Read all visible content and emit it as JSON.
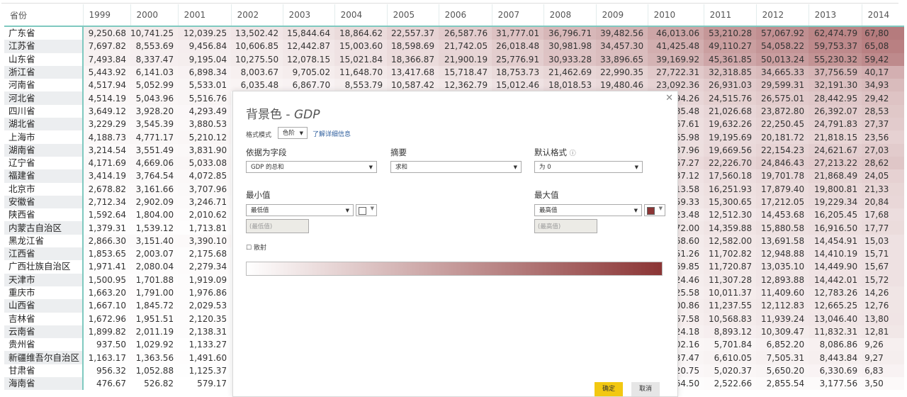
{
  "table": {
    "header_label": "省份",
    "years": [
      "1999",
      "2000",
      "2001",
      "2002",
      "2003",
      "2004",
      "2005",
      "2006",
      "2007",
      "2008",
      "2009",
      "2010",
      "2011",
      "2012",
      "2013",
      "2014"
    ],
    "rows": [
      {
        "province": "广东省",
        "values": [
          "9,250.68",
          "10,741.25",
          "12,039.25",
          "13,502.42",
          "15,844.64",
          "18,864.62",
          "22,557.37",
          "26,587.76",
          "31,777.01",
          "36,796.71",
          "39,482.56",
          "46,013.06",
          "53,210.28",
          "57,067.92",
          "62,474.79",
          "67,80"
        ]
      },
      {
        "province": "江苏省",
        "values": [
          "7,697.82",
          "8,553.69",
          "9,456.84",
          "10,606.85",
          "12,442.87",
          "15,003.60",
          "18,598.69",
          "21,742.05",
          "26,018.48",
          "30,981.98",
          "34,457.30",
          "41,425.48",
          "49,110.27",
          "54,058.22",
          "59,753.37",
          "65,08"
        ]
      },
      {
        "province": "山东省",
        "values": [
          "7,493.84",
          "8,337.47",
          "9,195.04",
          "10,275.50",
          "12,078.15",
          "15,021.84",
          "18,366.87",
          "21,900.19",
          "25,776.91",
          "30,933.28",
          "33,896.65",
          "39,169.92",
          "45,361.85",
          "50,013.24",
          "55,230.32",
          "59,42"
        ]
      },
      {
        "province": "浙江省",
        "values": [
          "5,443.92",
          "6,141.03",
          "6,898.34",
          "8,003.67",
          "9,705.02",
          "11,648.70",
          "13,417.68",
          "15,718.47",
          "18,753.73",
          "21,462.69",
          "22,990.35",
          "27,722.31",
          "32,318.85",
          "34,665.33",
          "37,756.59",
          "40,17"
        ]
      },
      {
        "province": "河南省",
        "values": [
          "4,517.94",
          "5,052.99",
          "5,533.01",
          "6,035.48",
          "6,867.70",
          "8,553.79",
          "10,587.42",
          "12,362.79",
          "15,012.46",
          "18,018.53",
          "19,480.46",
          "23,092.36",
          "26,931.03",
          "29,599.31",
          "32,191.30",
          "34,93"
        ]
      },
      {
        "province": "河北省",
        "values": [
          "4,514.19",
          "5,043.96",
          "5,516.76",
          "",
          "",
          "",
          "",
          "",
          "",
          "",
          "",
          "94.26",
          "24,515.76",
          "26,575.01",
          "28,442.95",
          "29,42"
        ]
      },
      {
        "province": "四川省",
        "values": [
          "3,649.12",
          "3,928.20",
          "4,293.49",
          "",
          "",
          "",
          "",
          "",
          "",
          "",
          "",
          "85.48",
          "21,026.68",
          "23,872.80",
          "26,392.07",
          "28,53"
        ]
      },
      {
        "province": "湖北省",
        "values": [
          "3,229.29",
          "3,545.39",
          "3,880.53",
          "",
          "",
          "",
          "",
          "",
          "",
          "",
          "",
          "67.61",
          "19,632.26",
          "22,250.45",
          "24,791.83",
          "27,37"
        ]
      },
      {
        "province": "上海市",
        "values": [
          "4,188.73",
          "4,771.17",
          "5,210.12",
          "",
          "",
          "",
          "",
          "",
          "",
          "",
          "",
          "65.98",
          "19,195.69",
          "20,181.72",
          "21,818.15",
          "23,56"
        ]
      },
      {
        "province": "湖南省",
        "values": [
          "3,214.54",
          "3,551.49",
          "3,831.90",
          "",
          "",
          "",
          "",
          "",
          "",
          "",
          "",
          "37.96",
          "19,669.56",
          "22,154.23",
          "24,621.67",
          "27,03"
        ]
      },
      {
        "province": "辽宁省",
        "values": [
          "4,171.69",
          "4,669.06",
          "5,033.08",
          "",
          "",
          "",
          "",
          "",
          "",
          "",
          "",
          "57.27",
          "22,226.70",
          "24,846.43",
          "27,213.22",
          "28,62"
        ]
      },
      {
        "province": "福建省",
        "values": [
          "3,414.19",
          "3,764.54",
          "4,072.85",
          "",
          "",
          "",
          "",
          "",
          "",
          "",
          "",
          "37.12",
          "17,560.18",
          "19,701.78",
          "21,868.49",
          "24,05"
        ]
      },
      {
        "province": "北京市",
        "values": [
          "2,678.82",
          "3,161.66",
          "3,707.96",
          "",
          "",
          "",
          "",
          "",
          "",
          "",
          "",
          "13.58",
          "16,251.93",
          "17,879.40",
          "19,800.81",
          "21,33"
        ]
      },
      {
        "province": "安徽省",
        "values": [
          "2,712.34",
          "2,902.09",
          "3,246.71",
          "",
          "",
          "",
          "",
          "",
          "",
          "",
          "",
          "59.33",
          "15,300.65",
          "17,212.05",
          "19,229.34",
          "20,84"
        ]
      },
      {
        "province": "陕西省",
        "values": [
          "1,592.64",
          "1,804.00",
          "2,010.62",
          "",
          "",
          "",
          "",
          "",
          "",
          "",
          "",
          "23.48",
          "12,512.30",
          "14,453.68",
          "16,205.45",
          "17,68"
        ]
      },
      {
        "province": "内蒙古自治区",
        "values": [
          "1,379.31",
          "1,539.12",
          "1,713.81",
          "",
          "",
          "",
          "",
          "",
          "",
          "",
          "",
          "72.00",
          "14,359.88",
          "15,880.58",
          "16,916.50",
          "17,77"
        ]
      },
      {
        "province": "黑龙江省",
        "values": [
          "2,866.30",
          "3,151.40",
          "3,390.10",
          "",
          "",
          "",
          "",
          "",
          "",
          "",
          "",
          "68.60",
          "12,582.00",
          "13,691.58",
          "14,454.91",
          "15,03"
        ]
      },
      {
        "province": "江西省",
        "values": [
          "1,853.65",
          "2,003.07",
          "2,175.68",
          "",
          "",
          "",
          "",
          "",
          "",
          "",
          "",
          "51.26",
          "11,702.82",
          "12,948.88",
          "14,410.19",
          "15,71"
        ]
      },
      {
        "province": "广西壮族自治区",
        "values": [
          "1,971.41",
          "2,080.04",
          "2,279.34",
          "",
          "",
          "",
          "",
          "",
          "",
          "",
          "",
          "69.85",
          "11,720.87",
          "13,035.10",
          "14,449.90",
          "15,67"
        ]
      },
      {
        "province": "天津市",
        "values": [
          "1,500.95",
          "1,701.88",
          "1,919.09",
          "",
          "",
          "",
          "",
          "",
          "",
          "",
          "",
          "24.46",
          "11,307.28",
          "12,893.88",
          "14,442.01",
          "15,72"
        ]
      },
      {
        "province": "重庆市",
        "values": [
          "1,663.20",
          "1,791.00",
          "1,976.86",
          "",
          "",
          "",
          "",
          "",
          "",
          "",
          "",
          "25.58",
          "10,011.37",
          "11,409.60",
          "12,783.26",
          "14,26"
        ]
      },
      {
        "province": "山西省",
        "values": [
          "1,667.10",
          "1,845.72",
          "2,029.53",
          "",
          "",
          "",
          "",
          "",
          "",
          "",
          "",
          "00.86",
          "11,237.55",
          "12,112.83",
          "12,665.25",
          "12,76"
        ]
      },
      {
        "province": "吉林省",
        "values": [
          "1,672.96",
          "1,951.51",
          "2,120.35",
          "",
          "",
          "",
          "",
          "",
          "",
          "",
          "",
          "67.58",
          "10,568.83",
          "11,939.24",
          "13,046.40",
          "13,80"
        ]
      },
      {
        "province": "云南省",
        "values": [
          "1,899.82",
          "2,011.19",
          "2,138.31",
          "",
          "",
          "",
          "",
          "",
          "",
          "",
          "",
          "24.18",
          "8,893.12",
          "10,309.47",
          "11,832.31",
          "12,81"
        ]
      },
      {
        "province": "贵州省",
        "values": [
          "937.50",
          "1,029.92",
          "1,133.27",
          "",
          "",
          "",
          "",
          "",
          "",
          "",
          "",
          "02.16",
          "5,701.84",
          "6,852.20",
          "8,086.86",
          "9,26"
        ]
      },
      {
        "province": "新疆维吾尔自治区",
        "values": [
          "1,163.17",
          "1,363.56",
          "1,491.60",
          "",
          "",
          "",
          "",
          "",
          "",
          "",
          "",
          "37.47",
          "6,610.05",
          "7,505.31",
          "8,443.84",
          "9,27"
        ]
      },
      {
        "province": "甘肃省",
        "values": [
          "956.32",
          "1,052.88",
          "1,125.37",
          "",
          "",
          "",
          "",
          "",
          "",
          "",
          "",
          "20.75",
          "5,020.37",
          "5,650.20",
          "6,330.69",
          "6,83"
        ]
      },
      {
        "province": "海南省",
        "values": [
          "476.67",
          "526.82",
          "579.17",
          "",
          "",
          "",
          "",
          "",
          "",
          "",
          "",
          "64.50",
          "2,522.66",
          "2,855.54",
          "3,177.56",
          "3,50"
        ]
      }
    ]
  },
  "dialog": {
    "title_main": "背景色 - ",
    "title_field": "GDP",
    "format_mode_label": "格式模式",
    "format_mode_value": "色阶",
    "learn_more": "了解详细信息",
    "based_on_label": "依据为字段",
    "based_on_value": "GDP 的总和",
    "summary_label": "摘要",
    "summary_value": "求和",
    "default_label": "默认格式",
    "default_value": "为 0",
    "min_label": "最小值",
    "min_select": "最低值",
    "min_input": "(最低值)",
    "min_color": "#ffffff",
    "max_label": "最大值",
    "max_select": "最高值",
    "max_input": "(最高值)",
    "max_color": "#8b3535",
    "diverging_label": "散射",
    "ok_label": "确定",
    "cancel_label": "取消"
  },
  "colors": {
    "scale_min": "#ffffff",
    "scale_max": "#b57a7c",
    "accent": "#7fc9c0",
    "ok_button": "#f2c811"
  }
}
